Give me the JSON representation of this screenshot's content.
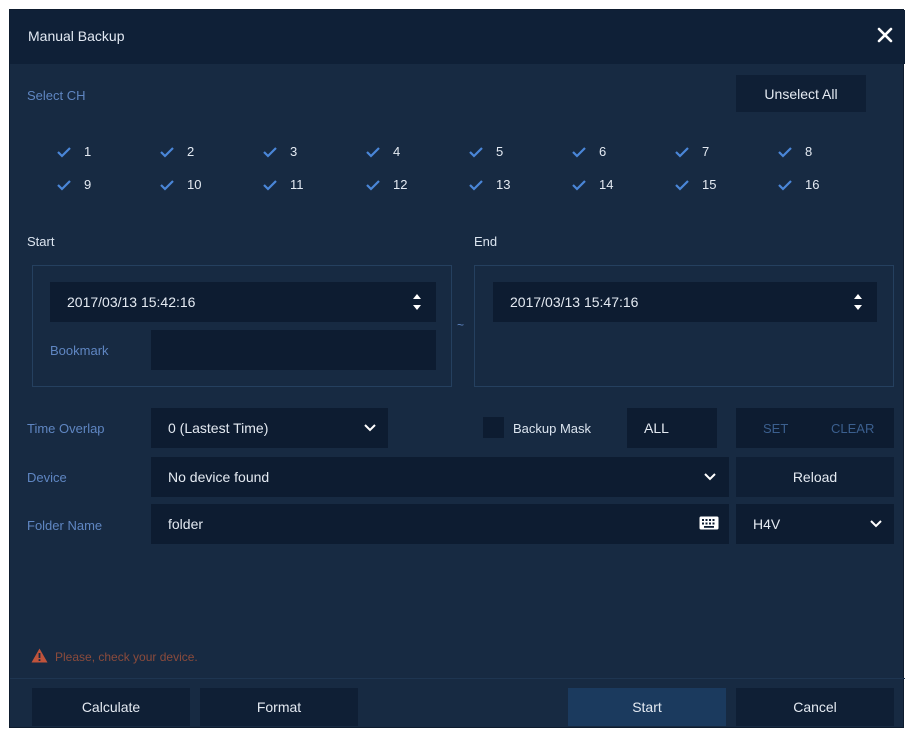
{
  "dialog": {
    "title": "Manual Backup"
  },
  "channels": {
    "label": "Select CH",
    "unselect_all": "Unselect All",
    "items": [
      "1",
      "2",
      "3",
      "4",
      "5",
      "6",
      "7",
      "8",
      "9",
      "10",
      "11",
      "12",
      "13",
      "14",
      "15",
      "16"
    ]
  },
  "start": {
    "label": "Start",
    "datetime": "2017/03/13 15:42:16",
    "bookmark_label": "Bookmark",
    "bookmark_value": ""
  },
  "range_separator": "~",
  "end": {
    "label": "End",
    "datetime": "2017/03/13 15:47:16"
  },
  "time_overlap": {
    "label": "Time Overlap",
    "value": "0 (Lastest Time)"
  },
  "backup_mask": {
    "label": "Backup Mask",
    "value": "ALL",
    "set": "SET",
    "clear": "CLEAR"
  },
  "device": {
    "label": "Device",
    "value": "No device found",
    "reload": "Reload"
  },
  "folder": {
    "label": "Folder Name",
    "value": "folder",
    "format_value": "H4V"
  },
  "warning": {
    "text": "Please, check your device."
  },
  "footer": {
    "calculate": "Calculate",
    "format": "Format",
    "start": "Start",
    "cancel": "Cancel"
  },
  "colors": {
    "background": "#172a42",
    "titlebar": "#0f2037",
    "accent_label": "#5f86c2",
    "check": "#4a86d8",
    "warning": "#c0533b"
  }
}
